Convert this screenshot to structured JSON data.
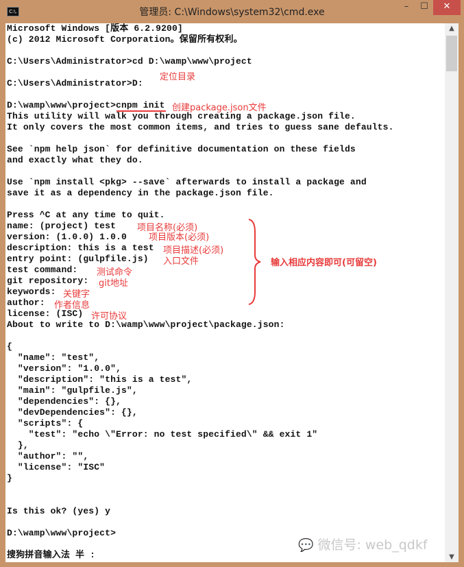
{
  "window": {
    "title": "管理员: C:\\Windows\\system32\\cmd.exe",
    "icon_label": "C:\\.",
    "minimize": "–",
    "maximize": "☐",
    "close": "✕"
  },
  "console_lines": [
    "Microsoft Windows [版本 6.2.9200]",
    "(c) 2012 Microsoft Corporation。保留所有权利。",
    "",
    "C:\\Users\\Administrator>cd D:\\wamp\\www\\project",
    "",
    "C:\\Users\\Administrator>D:",
    "",
    "D:\\wamp\\www\\project>cnpm init",
    "This utility will walk you through creating a package.json file.",
    "It only covers the most common items, and tries to guess sane defaults.",
    "",
    "See `npm help json` for definitive documentation on these fields",
    "and exactly what they do.",
    "",
    "Use `npm install <pkg> --save` afterwards to install a package and",
    "save it as a dependency in the package.json file.",
    "",
    "Press ^C at any time to quit.",
    "name: (project) test",
    "version: (1.0.0) 1.0.0",
    "description: this is a test",
    "entry point: (gulpfile.js)",
    "test command:",
    "git repository:",
    "keywords:",
    "author:",
    "license: (ISC)",
    "About to write to D:\\wamp\\www\\project\\package.json:",
    "",
    "{",
    "  \"name\": \"test\",",
    "  \"version\": \"1.0.0\",",
    "  \"description\": \"this is a test\",",
    "  \"main\": \"gulpfile.js\",",
    "  \"dependencies\": {},",
    "  \"devDependencies\": {},",
    "  \"scripts\": {",
    "    \"test\": \"echo \\\"Error: no test specified\\\" && exit 1\"",
    "  },",
    "  \"author\": \"\",",
    "  \"license\": \"ISC\"",
    "}",
    "",
    "",
    "Is this ok? (yes) y",
    "",
    "D:\\wamp\\www\\project>",
    "",
    "搜狗拼音输入法 半 :"
  ],
  "annotations": {
    "locate_dir": "定位目录",
    "create_package": "创建package.json文件",
    "name": "项目名称(必须)",
    "version": "项目版本(必须)",
    "description": "项目描述(必须)",
    "entry": "入口文件",
    "test": "测试命令",
    "git": "git地址",
    "keywords": "关键字",
    "author": "作者信息",
    "license": "许可协议",
    "summary": "输入相应内容即可(可留空)"
  },
  "watermark": "微信号: web_qdkf",
  "colors": {
    "accent": "#e83a3a",
    "frame": "#c8956a",
    "close": "#c7504a"
  }
}
